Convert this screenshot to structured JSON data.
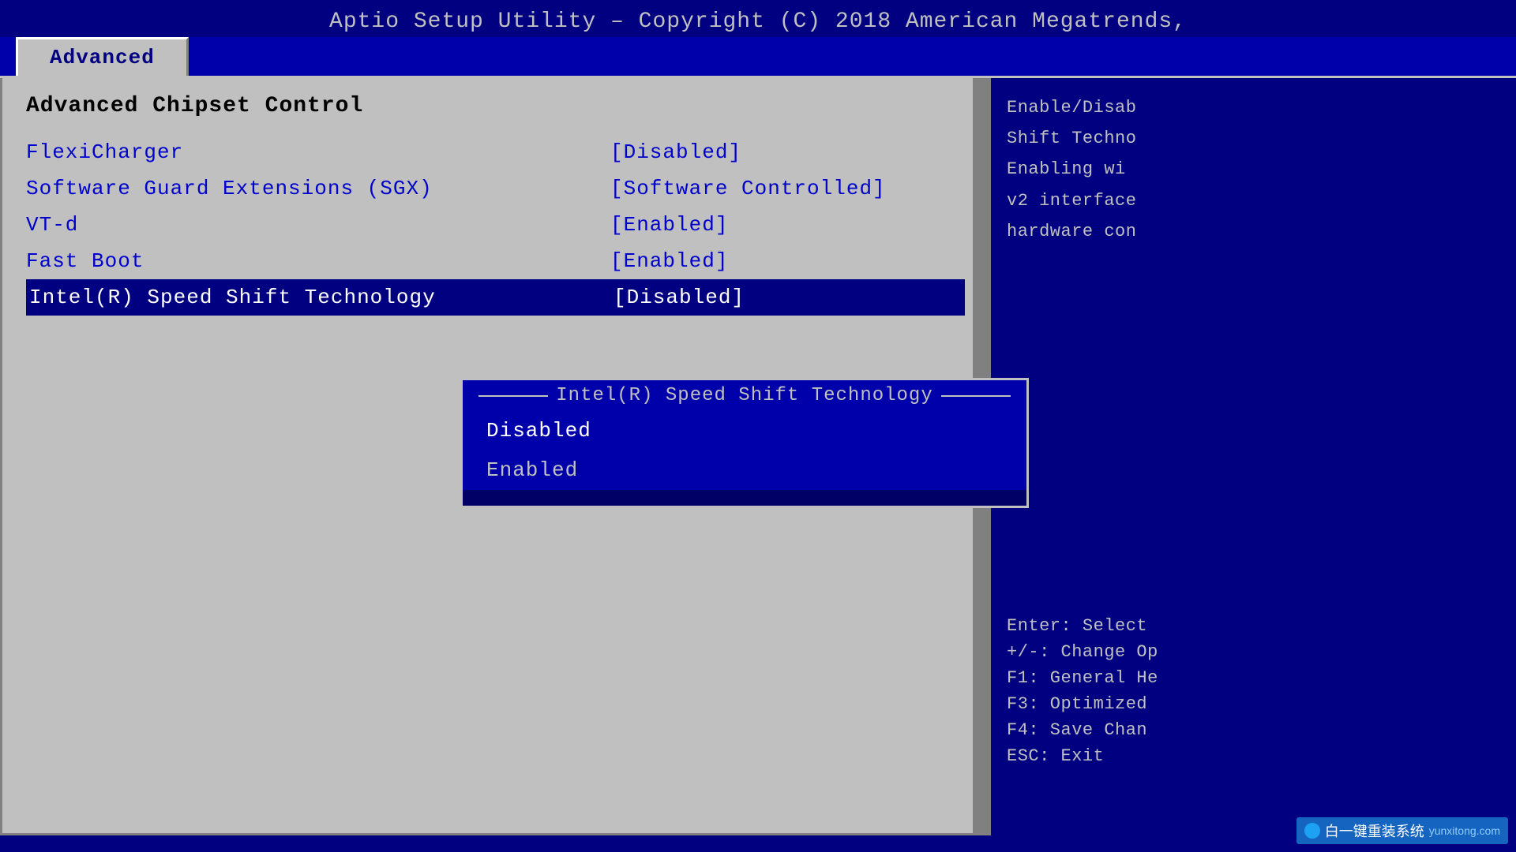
{
  "title": {
    "text": "Aptio Setup Utility – Copyright (C) 2018 American Megatrends,"
  },
  "tabs": [
    {
      "label": "Advanced",
      "active": true
    }
  ],
  "left_panel": {
    "section_title": "Advanced Chipset Control",
    "menu_items": [
      {
        "label": "FlexiCharger",
        "value": "[Disabled]",
        "selected": false
      },
      {
        "label": "Software Guard Extensions (SGX)",
        "value": "[Software Controlled]",
        "selected": false
      },
      {
        "label": "VT-d",
        "value": "[Enabled]",
        "selected": false
      },
      {
        "label": "Fast Boot",
        "value": "[Enabled]",
        "selected": false
      },
      {
        "label": "Intel(R) Speed Shift Technology",
        "value": "[Disabled]",
        "selected": true
      }
    ]
  },
  "dropdown": {
    "title": "Intel(R) Speed Shift Technology",
    "options": [
      {
        "label": "Disabled",
        "selected": true
      },
      {
        "label": "Enabled",
        "selected": false
      }
    ]
  },
  "right_panel": {
    "help_lines": [
      "Enable/Disab",
      "Shift Techno",
      "Enabling wi",
      "v2 interface",
      "hardware con"
    ],
    "keys": [
      "Enter: Select",
      "+/-: Change Op",
      "F1: General He",
      "F3: Optimized",
      "F4: Save Chan",
      "ESC: Exit"
    ]
  },
  "watermark": {
    "text": "白一键重装系统",
    "sub": "yunxitong.com"
  }
}
